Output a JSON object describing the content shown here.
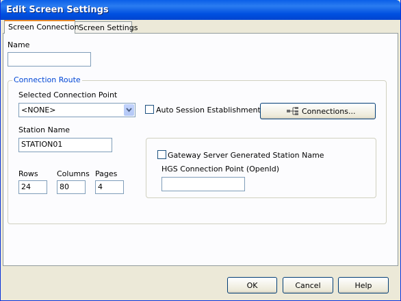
{
  "window": {
    "title": "Edit Screen Settings"
  },
  "tabs": [
    {
      "label": "Screen Connection",
      "active": true
    },
    {
      "label": "Screen Settings",
      "active": false
    }
  ],
  "fields": {
    "name_label": "Name",
    "name_value": ""
  },
  "connection_route": {
    "legend": "Connection Route",
    "selected_point_label": "Selected Connection Point",
    "selected_point_value": "<NONE>",
    "auto_session_label": "Auto Session Establishment",
    "auto_session_checked": false,
    "connections_button": "Connections...",
    "station_name_label": "Station Name",
    "station_name_value": "STATION01",
    "rows_label": "Rows",
    "rows_value": "24",
    "columns_label": "Columns",
    "columns_value": "80",
    "pages_label": "Pages",
    "pages_value": "4"
  },
  "gateway": {
    "checkbox_label": "Gateway Server Generated Station Name",
    "checked": false,
    "hgs_label": "HGS Connection Point (OpenId)",
    "hgs_value": ""
  },
  "buttons": {
    "ok": "OK",
    "cancel": "Cancel",
    "help": "Help"
  },
  "colors": {
    "titlebar": "#0054e3",
    "window_bg": "#ece9d8",
    "legend": "#0046d5",
    "tab_accent": "#e68b2c"
  }
}
